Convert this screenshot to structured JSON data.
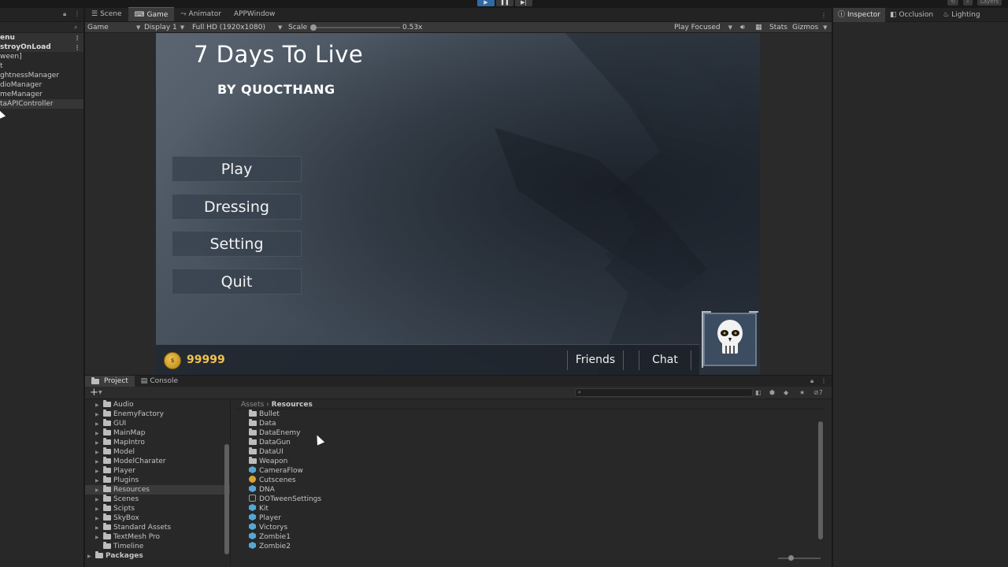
{
  "hierarchy": {
    "items": [
      "enu",
      "stroyOnLoad",
      "ween]",
      "t",
      "ghtnessManager",
      "dioManager",
      "meManager",
      "taAPIController"
    ]
  },
  "tabs": {
    "scene": "Scene",
    "game": "Game",
    "animator": "Animator",
    "app_window": "APPWindow"
  },
  "game_toolbar": {
    "mode": "Game",
    "display": "Display 1",
    "resolution": "Full HD (1920x1080)",
    "scale_label": "Scale",
    "scale_value": "0.53x",
    "play_mode": "Play Focused",
    "stats": "Stats",
    "gizmos": "Gizmos"
  },
  "game": {
    "title": "7 Days To Live",
    "subtitle": "BY QUOCTHANG",
    "menu": [
      "Play",
      "Dressing",
      "Setting",
      "Quit"
    ],
    "coins": "99999",
    "friends": "Friends",
    "chat": "Chat"
  },
  "project": {
    "tab_project": "Project",
    "tab_console": "Console",
    "folders": [
      "Audio",
      "EnemyFactory",
      "GUI",
      "MainMap",
      "MapIntro",
      "Model",
      "ModelCharater",
      "Player",
      "Plugins",
      "Resources",
      "Scenes",
      "Scipts",
      "SkyBox",
      "Standard Assets",
      "TextMesh Pro",
      "Timeline"
    ],
    "packages": "Packages",
    "breadcrumb_root": "Assets",
    "breadcrumb_current": "Resources",
    "files": [
      {
        "name": "Bullet",
        "kind": "folder"
      },
      {
        "name": "Data",
        "kind": "folder"
      },
      {
        "name": "DataEnemy",
        "kind": "folder"
      },
      {
        "name": "DataGun",
        "kind": "folder"
      },
      {
        "name": "DataUI",
        "kind": "folder"
      },
      {
        "name": "Weapon",
        "kind": "folder"
      },
      {
        "name": "CameraFlow",
        "kind": "prefab"
      },
      {
        "name": "Cutscenes",
        "kind": "timeline"
      },
      {
        "name": "DNA",
        "kind": "prefab"
      },
      {
        "name": "DOTweenSettings",
        "kind": "asset"
      },
      {
        "name": "Kit",
        "kind": "prefab"
      },
      {
        "name": "Player",
        "kind": "prefab"
      },
      {
        "name": "Victorys",
        "kind": "prefab"
      },
      {
        "name": "Zombie1",
        "kind": "prefab"
      },
      {
        "name": "Zombie2",
        "kind": "prefab"
      }
    ],
    "hidden_count": "7"
  },
  "inspector": {
    "tab_inspector": "Inspector",
    "tab_occlusion": "Occlusion",
    "tab_lighting": "Lighting",
    "layers": "Layers"
  },
  "colors": {
    "play_active": "#2f6aa5",
    "coin": "#f2c24c",
    "prefab": "#56a6d4"
  }
}
